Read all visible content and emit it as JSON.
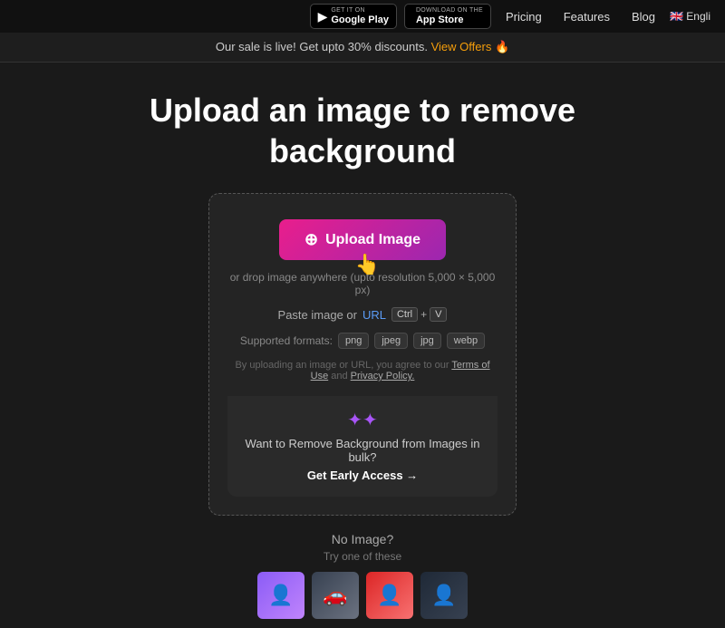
{
  "navbar": {
    "google_play": {
      "sub": "GET IT ON",
      "main": "Google Play"
    },
    "app_store": {
      "sub": "Download on the",
      "main": "App Store"
    },
    "links": [
      "Pricing",
      "Features",
      "Blog"
    ],
    "lang": "🇬🇧 Engli"
  },
  "banner": {
    "text": "Our sale is live! Get upto 30% discounts.",
    "cta": "View Offers",
    "emoji": "🔥"
  },
  "hero": {
    "title_line1": "Upload an image to remove",
    "title_line2": "background"
  },
  "upload": {
    "button_label": "Upload Image",
    "drop_hint": "or drop image anywhere (upto resolution 5,000 × 5,000 px)",
    "paste_label": "Paste image or",
    "url_label": "URL",
    "shortcut_ctrl": "Ctrl",
    "shortcut_plus": "+",
    "shortcut_v": "V",
    "formats_label": "Supported formats:",
    "formats": [
      "png",
      "jpeg",
      "jpg",
      "webp"
    ],
    "terms": "By uploading an image or URL, you agree to our",
    "terms_link1": "Terms of Use",
    "terms_and": "and",
    "terms_link2": "Privacy Policy."
  },
  "bulk": {
    "text": "Want to Remove Background from Images in bulk?",
    "cta": "Get Early Access →"
  },
  "no_image": {
    "title": "No Image?",
    "subtitle": "Try one of these"
  }
}
